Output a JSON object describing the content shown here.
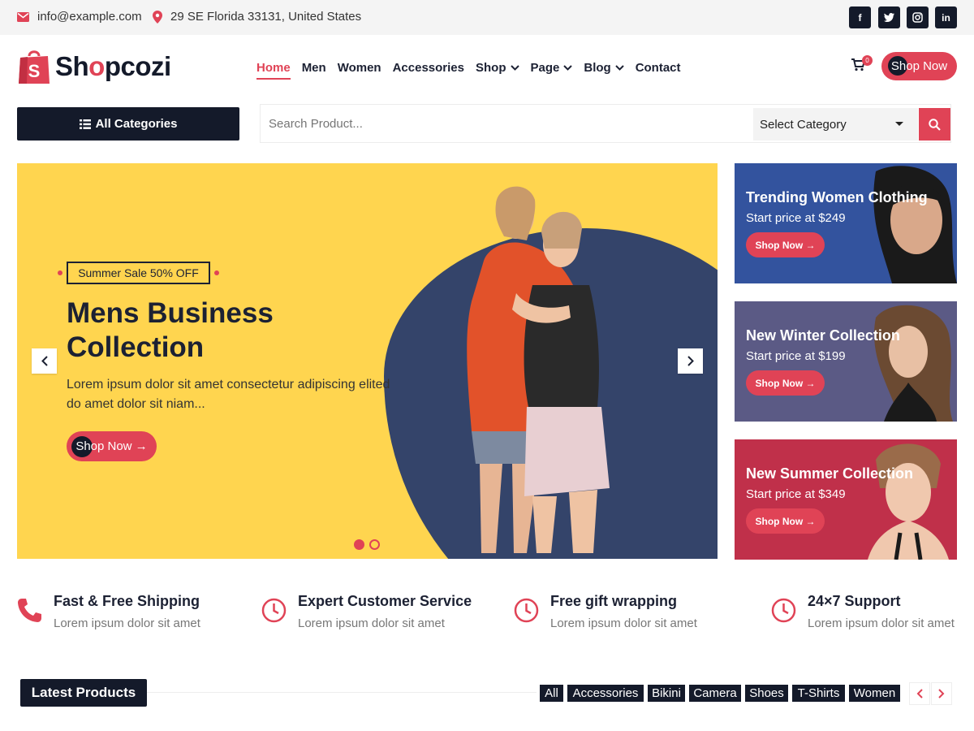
{
  "topbar": {
    "email": "info@example.com",
    "address": "29 SE Florida 33131, United States",
    "socials": [
      "f",
      "t",
      "ig",
      "in"
    ]
  },
  "header": {
    "brand_prefix": "Sh",
    "brand_o": "o",
    "brand_suffix": "pcozi",
    "nav": [
      "Home",
      "Men",
      "Women",
      "Accessories",
      "Shop",
      "Page",
      "Blog",
      "Contact"
    ],
    "cart_count": "0",
    "shop_now": "Shop Now"
  },
  "search": {
    "all_categories": "All Categories",
    "placeholder": "Search Product...",
    "select_category": "Select Category"
  },
  "hero": {
    "tag": "Summer Sale 50% OFF",
    "title": "Mens Business Collection",
    "description": "Lorem ipsum dolor sit amet consectetur adipiscing elited do amet dolor sit niam...",
    "button": "Shop Now →"
  },
  "banners": [
    {
      "title": "Trending Women Clothing",
      "price": "Start price at $249",
      "button": "Shop Now →",
      "color": "#33539e"
    },
    {
      "title": "New Winter Collection",
      "price": "Start price at $199",
      "button": "Shop Now →",
      "color": "#5b5a85"
    },
    {
      "title": "New Summer Collection",
      "price": "Start price at $349",
      "button": "Shop Now →",
      "color": "#c0304a"
    }
  ],
  "features": [
    {
      "title": "Fast & Free Shipping",
      "subtitle": "Lorem ipsum dolor sit amet",
      "icon": "phone-icon"
    },
    {
      "title": "Expert Customer Service",
      "subtitle": "Lorem ipsum dolor sit amet",
      "icon": "clock-icon"
    },
    {
      "title": "Free gift wrapping",
      "subtitle": "Lorem ipsum dolor sit amet",
      "icon": "clock-icon"
    },
    {
      "title": "24×7 Support",
      "subtitle": "Lorem ipsum dolor sit amet",
      "icon": "clock-icon"
    }
  ],
  "latest": {
    "title": "Latest Products",
    "filters": [
      "All",
      "Accessories",
      "Bikini",
      "Camera",
      "Shoes",
      "T-Shirts",
      "Women"
    ]
  },
  "colors": {
    "accent": "#e04356",
    "dark": "#141a2a",
    "hero_bg": "#ffd54f",
    "hero_blob": "#34446a"
  }
}
